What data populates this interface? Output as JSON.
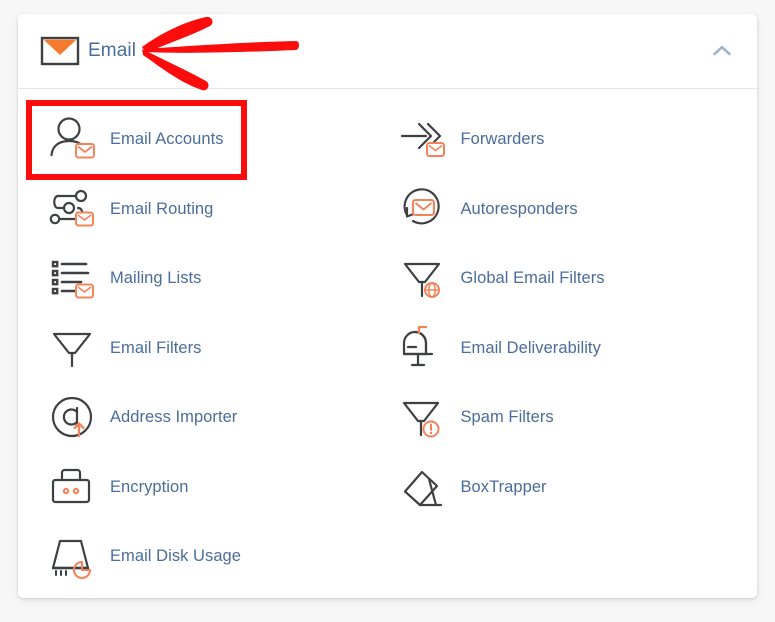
{
  "page": {
    "background_color": "#f7f7f7",
    "card_background": "#ffffff"
  },
  "colors": {
    "link_text": "#4a6d9c",
    "icon_stroke": "#3f4042",
    "icon_accent": "#f5835a",
    "header_accent": "#f47b30",
    "divider": "#e3e8ee",
    "chevron": "#9fb4cc",
    "annotation": "#fc0d0d"
  },
  "header": {
    "title": "Email",
    "icon": "envelope-icon",
    "collapse_icon": "chevron-up-icon",
    "expanded": true
  },
  "items": [
    {
      "label": "Email Accounts",
      "icon": "email-accounts-icon",
      "column": "left",
      "highlighted": true
    },
    {
      "label": "Forwarders",
      "icon": "forwarders-icon",
      "column": "right",
      "highlighted": false
    },
    {
      "label": "Email Routing",
      "icon": "email-routing-icon",
      "column": "left",
      "highlighted": false
    },
    {
      "label": "Autoresponders",
      "icon": "autoresponders-icon",
      "column": "right",
      "highlighted": false
    },
    {
      "label": "Mailing Lists",
      "icon": "mailing-lists-icon",
      "column": "left",
      "highlighted": false
    },
    {
      "label": "Global Email Filters",
      "icon": "global-email-filters-icon",
      "column": "right",
      "highlighted": false
    },
    {
      "label": "Email Filters",
      "icon": "email-filters-icon",
      "column": "left",
      "highlighted": false
    },
    {
      "label": "Email Deliverability",
      "icon": "email-deliverability-icon",
      "column": "right",
      "highlighted": false
    },
    {
      "label": "Address Importer",
      "icon": "address-importer-icon",
      "column": "left",
      "highlighted": false
    },
    {
      "label": "Spam Filters",
      "icon": "spam-filters-icon",
      "column": "right",
      "highlighted": false
    },
    {
      "label": "Encryption",
      "icon": "encryption-icon",
      "column": "left",
      "highlighted": false
    },
    {
      "label": "BoxTrapper",
      "icon": "boxtrapper-icon",
      "column": "right",
      "highlighted": false
    },
    {
      "label": "Email Disk Usage",
      "icon": "email-disk-usage-icon",
      "column": "left",
      "highlighted": false
    }
  ],
  "annotations": {
    "highlight_box_target": "Email Accounts",
    "arrow_target": "Email"
  }
}
